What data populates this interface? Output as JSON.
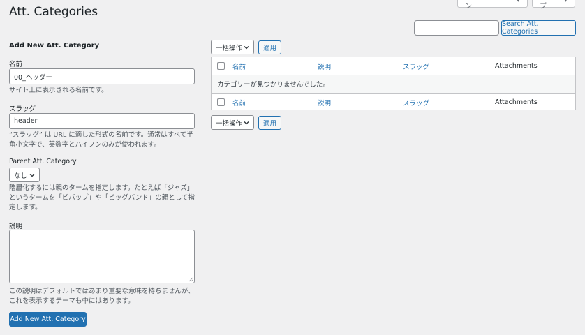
{
  "header": {
    "title": "Att. Categories",
    "screen_options_label": "表示オプション",
    "help_label": "ヘルプ"
  },
  "search": {
    "value": "",
    "button_label": "Search Att. Categories"
  },
  "form": {
    "heading": "Add New Att. Category",
    "name_label": "名前",
    "name_value": "00_ヘッダー",
    "name_desc": "サイト上に表示される名前です。",
    "slug_label": "スラッグ",
    "slug_value": "header",
    "slug_desc_line1": "“スラッグ” は URL に適した形式の名前です。通常はすべて半",
    "slug_desc_line2": "角小文字で、英数字とハイフンのみが使われます。",
    "parent_label": "Parent Att. Category",
    "parent_value": "なし",
    "parent_desc_line1": "階層化するには親のタームを指定します。たとえば「ジャズ」",
    "parent_desc_line2": "というタームを「ビバップ」や「ビッグバンド」の親として指",
    "parent_desc_line3": "定します。",
    "description_label": "説明",
    "description_value": "",
    "description_desc_line1": "この説明はデフォルトではあまり重要な意味を持ちませんが、",
    "description_desc_line2": "これを表示するテーマも中にはあります。",
    "submit_label": "Add New Att. Category"
  },
  "bulk": {
    "action_label": "一括操作",
    "apply_label": "適用"
  },
  "table": {
    "columns": [
      "名前",
      "説明",
      "スラッグ",
      "Attachments"
    ],
    "empty_message": "カテゴリーが見つかりませんでした。"
  },
  "colors": {
    "accent": "#2271b1",
    "background": "#f0f0f1"
  }
}
